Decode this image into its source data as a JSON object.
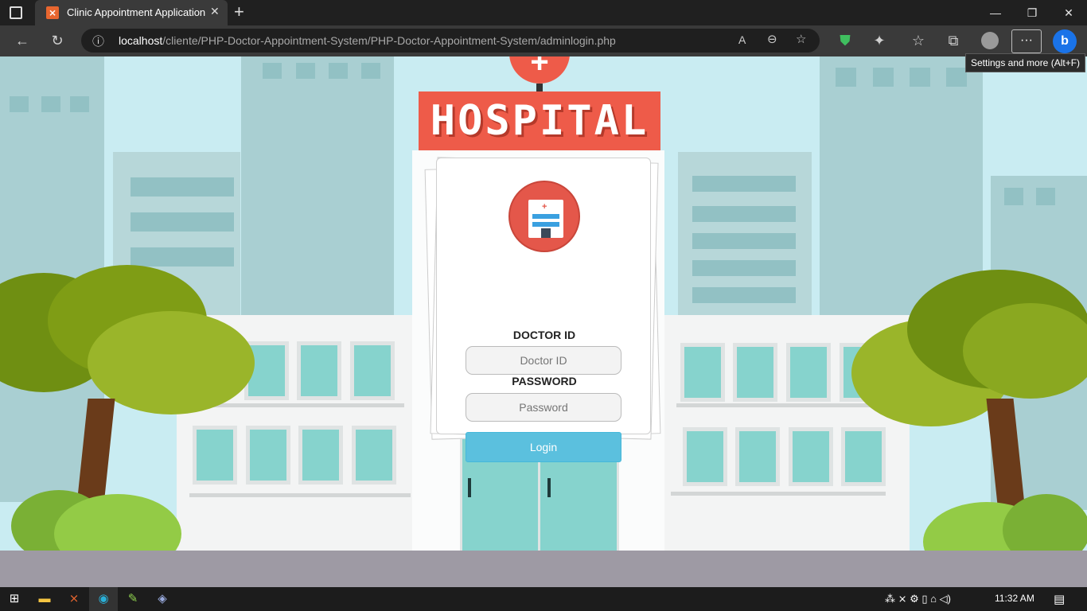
{
  "browser": {
    "tab_title": "Clinic Appointment Application",
    "url_host": "localhost",
    "url_path": "/cliente/PHP-Doctor-Appointment-System/PHP-Doctor-Appointment-System/adminlogin.php",
    "tooltip": "Settings and more (Alt+F)"
  },
  "page": {
    "sign_text": "HOSPITAL",
    "doctor_id_label": "DOCTOR ID",
    "doctor_id_placeholder": "Doctor ID",
    "password_label": "PASSWORD",
    "password_placeholder": "Password",
    "login_label": "Login"
  },
  "taskbar": {
    "time": "11:32 AM"
  },
  "colors": {
    "sign": "#ee5b49",
    "login_button": "#5bc0de",
    "sky": "#c9ecf2"
  }
}
